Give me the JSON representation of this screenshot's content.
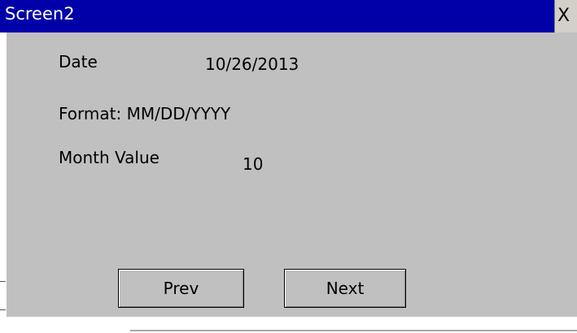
{
  "window": {
    "title": "Screen2",
    "close_glyph": "X"
  },
  "fields": {
    "date_label": "Date",
    "date_value": "10/26/2013",
    "format_text": "Format: MM/DD/YYYY",
    "month_label": "Month Value",
    "month_value": "10"
  },
  "buttons": {
    "prev_label": "Prev",
    "next_label": "Next"
  },
  "colors": {
    "titlebar": "#0000a8",
    "client_background": "#c0c0c0"
  }
}
